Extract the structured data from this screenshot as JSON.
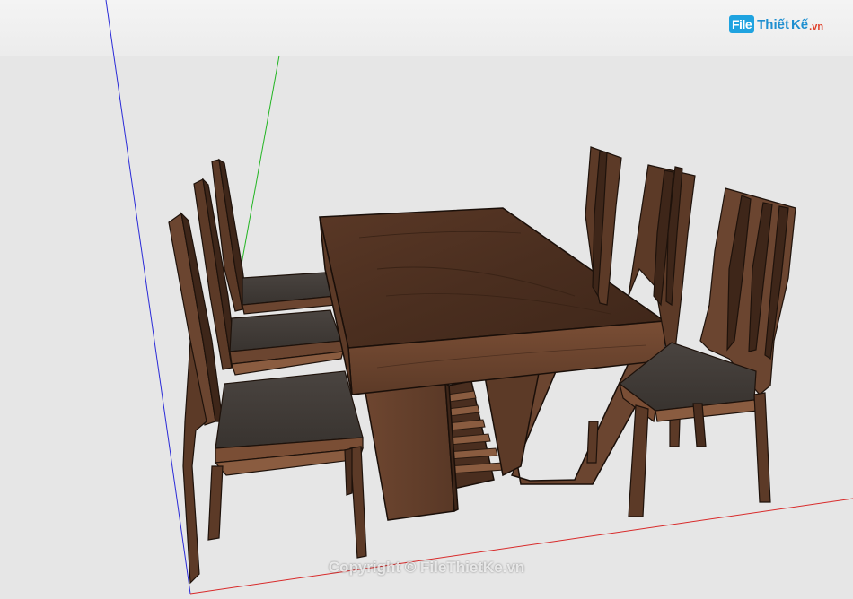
{
  "logo": {
    "file": "File",
    "thiet": "Thiết",
    "ke": "Kế",
    "vn": ".vn"
  },
  "watermark": "Copyright © FileThietKe.vn",
  "colors": {
    "ground": "#e6e6e6",
    "sky": "#efefef",
    "wood_dark": "#4a2f20",
    "wood_mid": "#6b4530",
    "wood_light": "#8a5c40",
    "seat": "#3f3a36",
    "axis_blue": "#2a2ad8",
    "axis_green": "#22b522",
    "axis_red": "#d82a2a"
  }
}
